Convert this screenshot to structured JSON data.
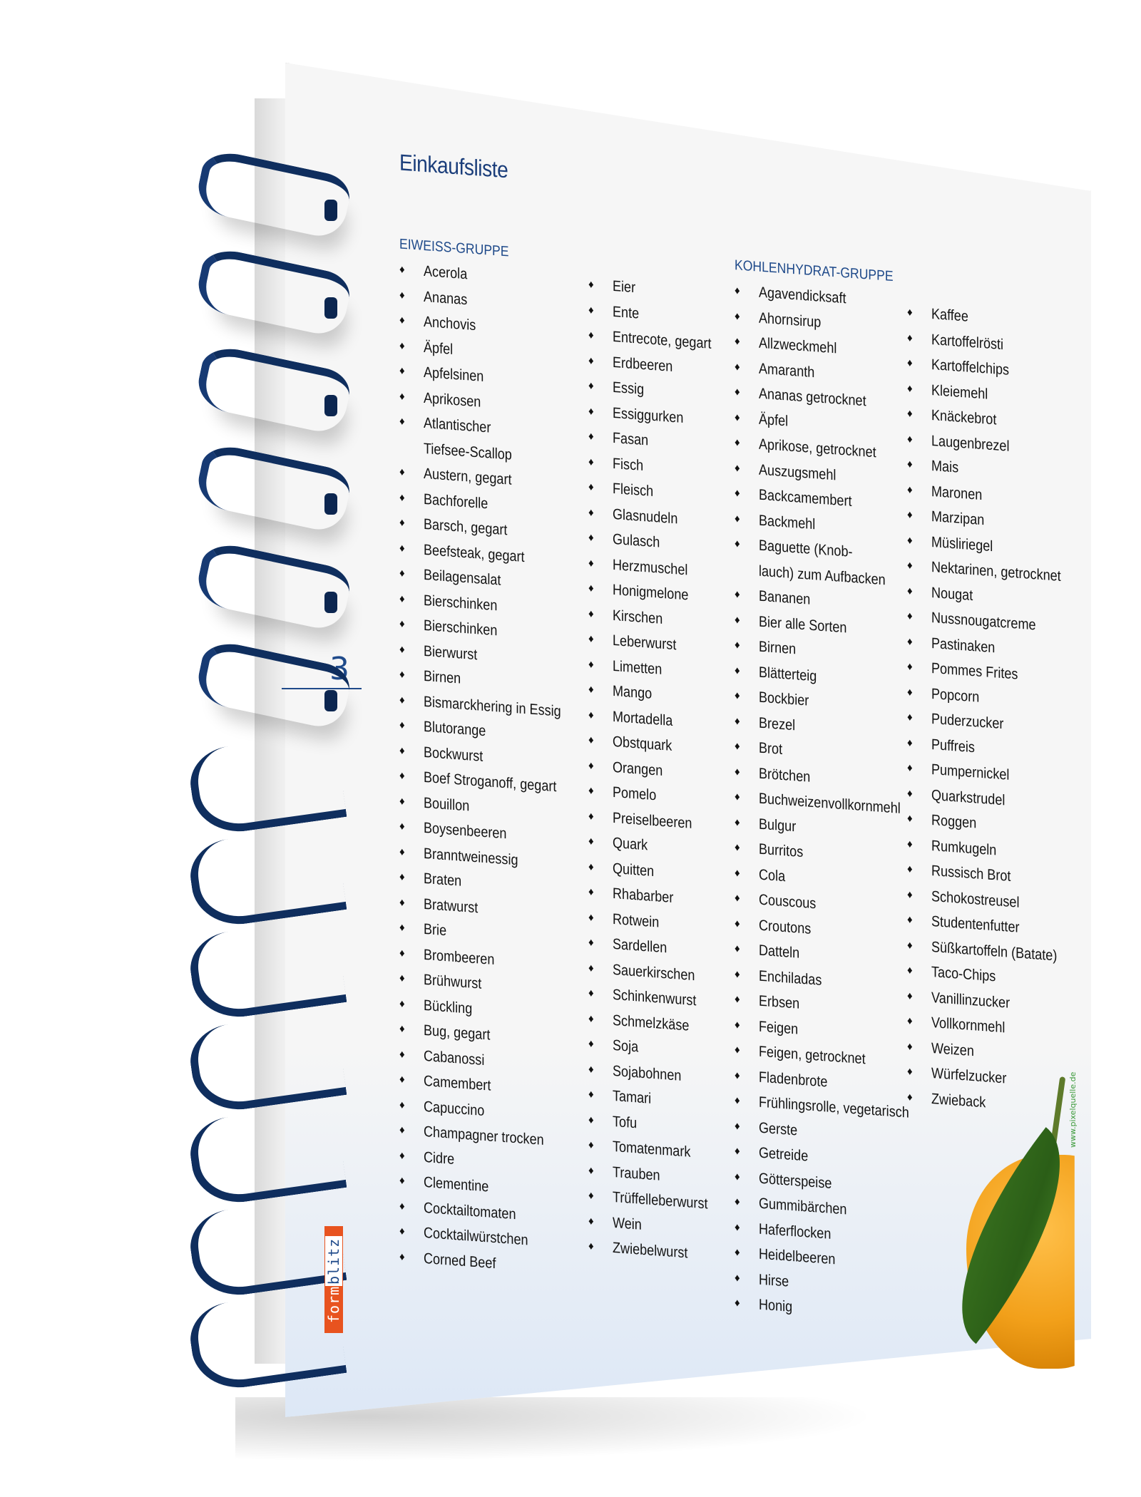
{
  "document": {
    "title": "Einkaufsliste",
    "page_number": "3",
    "brand_logo": {
      "part1": "form",
      "part2": "blitz"
    },
    "image_credit": "www.pixelquelle.de"
  },
  "groups": [
    {
      "heading": "EIWEISS-GRUPPE",
      "columns": [
        [
          "Acerola",
          "Ananas",
          "Anchovis",
          "Äpfel",
          "Apfelsinen",
          "Aprikosen",
          "Atlantischer",
          "Tiefsee-Scallop",
          "Austern, gegart",
          "Bachforelle",
          "Barsch, gegart",
          "Beefsteak, gegart",
          "Beilagensalat",
          "Bierschinken",
          "Bierschinken",
          "Bierwurst",
          "Birnen",
          "Bismarckhering in Essig",
          "Blutorange",
          "Bockwurst",
          "Boef Stroganoff, gegart",
          "Bouillon",
          "Boysenbeeren",
          "Branntweinessig",
          "Braten",
          "Bratwurst",
          "Brie",
          "Brombeeren",
          "Brühwurst",
          "Bückling",
          "Bug, gegart",
          "Cabanossi",
          "Camembert",
          "Capuccino",
          "Champagner trocken",
          "Cidre",
          "Clementine",
          "Cocktailtomaten",
          "Cocktailwürstchen",
          "Corned Beef"
        ],
        [
          "Eier",
          "Ente",
          "Entrecote, gegart",
          "Erdbeeren",
          "Essig",
          "Essiggurken",
          "Fasan",
          "Fisch",
          "Fleisch",
          "Glasnudeln",
          "Gulasch",
          "Herzmuschel",
          "Honigmelone",
          "Kirschen",
          "Leberwurst",
          "Limetten",
          "Mango",
          "Mortadella",
          "Obstquark",
          "Orangen",
          "Pomelo",
          "Preiselbeeren",
          "Quark",
          "Quitten",
          "Rhabarber",
          "Rotwein",
          "Sardellen",
          "Sauerkirschen",
          "Schinkenwurst",
          "Schmelzkäse",
          "Soja",
          "Sojabohnen",
          "Tamari",
          "Tofu",
          "Tomatenmark",
          "Trauben",
          "Trüffelleberwurst",
          "Wein",
          "Zwiebelwurst"
        ]
      ]
    },
    {
      "heading": "KOHLENHYDRAT-GRUPPE",
      "columns": [
        [
          "Agavendicksaft",
          "Ahornsirup",
          "Allzweckmehl",
          "Amaranth",
          "Ananas getrocknet",
          "Äpfel",
          "Aprikose, getrocknet",
          "Auszugsmehl",
          "Backcamembert",
          "Backmehl",
          "Baguette (Knob-",
          "lauch) zum Aufbacken",
          "Bananen",
          "Bier alle Sorten",
          "Birnen",
          "Blätterteig",
          "Bockbier",
          "Brezel",
          "Brot",
          "Brötchen",
          "Buchweizenvollkornmehl",
          "Bulgur",
          "Burritos",
          "Cola",
          "Couscous",
          "Croutons",
          "Datteln",
          "Enchiladas",
          "Erbsen",
          "Feigen",
          "Feigen, getrocknet",
          "Fladenbrote",
          "Frühlingsrolle, vegetarisch",
          "Gerste",
          "Getreide",
          "Götterspeise",
          "Gummibärchen",
          "Haferflocken",
          "Heidelbeeren",
          "Hirse",
          "Honig"
        ],
        [
          "Kaffee",
          "Kartoffelrösti",
          "Kartoffelchips",
          "Kleiemehl",
          "Knäckebrot",
          "Laugenbrezel",
          "Mais",
          "Maronen",
          "Marzipan",
          "Müsliriegel",
          "Nektarinen, getrocknet",
          "Nougat",
          "Nussnougatcreme",
          "Pastinaken",
          "Pommes Frites",
          "Popcorn",
          "Puderzucker",
          "Puffreis",
          "Pumpernickel",
          "Quarkstrudel",
          "Roggen",
          "Rumkugeln",
          "Russisch Brot",
          "Schokostreusel",
          "Studentenfutter",
          "Süßkartoffeln (Batate)",
          "Taco-Chips",
          "Vanillinzucker",
          "Vollkornmehl",
          "Weizen",
          "Würfelzucker",
          "Zwieback"
        ]
      ]
    }
  ],
  "continuation_lines": [
    "Tiefsee-Scallop",
    "lauch) zum Aufbacken"
  ],
  "bullet_glyph": "♦",
  "colors": {
    "heading_blue": "#1f4a8a",
    "spiral_navy": "#0f2e5e",
    "logo_orange": "#e8531f",
    "credit_green": "#3b9a3a"
  }
}
